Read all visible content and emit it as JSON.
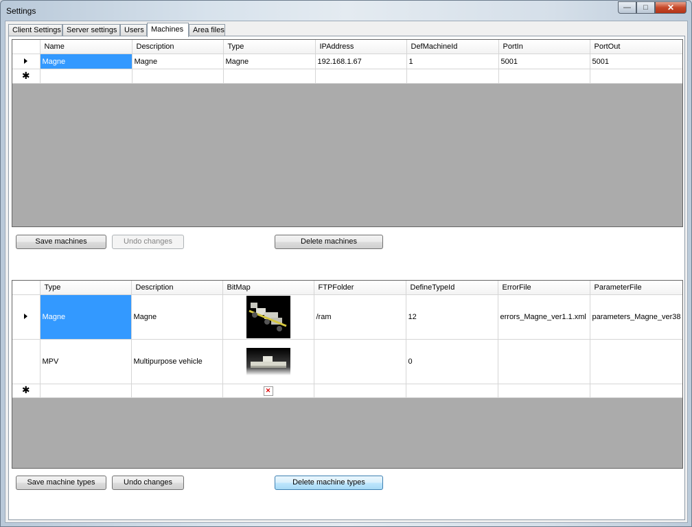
{
  "window": {
    "title": "Settings"
  },
  "tabs": [
    {
      "label": "Client Settings"
    },
    {
      "label": "Server settings"
    },
    {
      "label": "Users"
    },
    {
      "label": "Machines"
    },
    {
      "label": "Area files"
    }
  ],
  "machines_grid": {
    "columns": [
      "Name",
      "Description",
      "Type",
      "IPAddress",
      "DefMachineId",
      "PortIn",
      "PortOut"
    ],
    "rows": [
      {
        "name": "Magne",
        "description": "Magne",
        "type": "Magne",
        "ip": "192.168.1.67",
        "def_machine_id": "1",
        "port_in": "5001",
        "port_out": "5001"
      }
    ]
  },
  "machines_buttons": {
    "save": "Save machines",
    "undo": "Undo changes",
    "delete": "Delete machines"
  },
  "types_grid": {
    "columns": [
      "Type",
      "Description",
      "BitMap",
      "FTPFolder",
      "DefineTypeId",
      "ErrorFile",
      "ParameterFile"
    ],
    "rows": [
      {
        "type": "Magne",
        "description": "Magne",
        "bitmap": "vehicle-image",
        "ftp_folder": "/ram",
        "define_type_id": "12",
        "error_file": "errors_Magne_ver1.1.xml",
        "parameter_file": "parameters_Magne_ver38"
      },
      {
        "type": "MPV",
        "description": "Multipurpose vehicle",
        "bitmap": "vehicle-image",
        "ftp_folder": "",
        "define_type_id": "0",
        "error_file": "",
        "parameter_file": ""
      }
    ]
  },
  "types_buttons": {
    "save": "Save machine types",
    "undo": "Undo changes",
    "delete": "Delete machine types"
  },
  "icons": {
    "close": "close-icon",
    "minimize": "minimize-icon",
    "maximize": "maximize-icon",
    "current_row": "row-pointer-icon",
    "new_row": "new-row-icon",
    "broken_image": "broken-image-icon"
  },
  "colors": {
    "selection": "#3399ff",
    "grid_background": "#ababab"
  }
}
